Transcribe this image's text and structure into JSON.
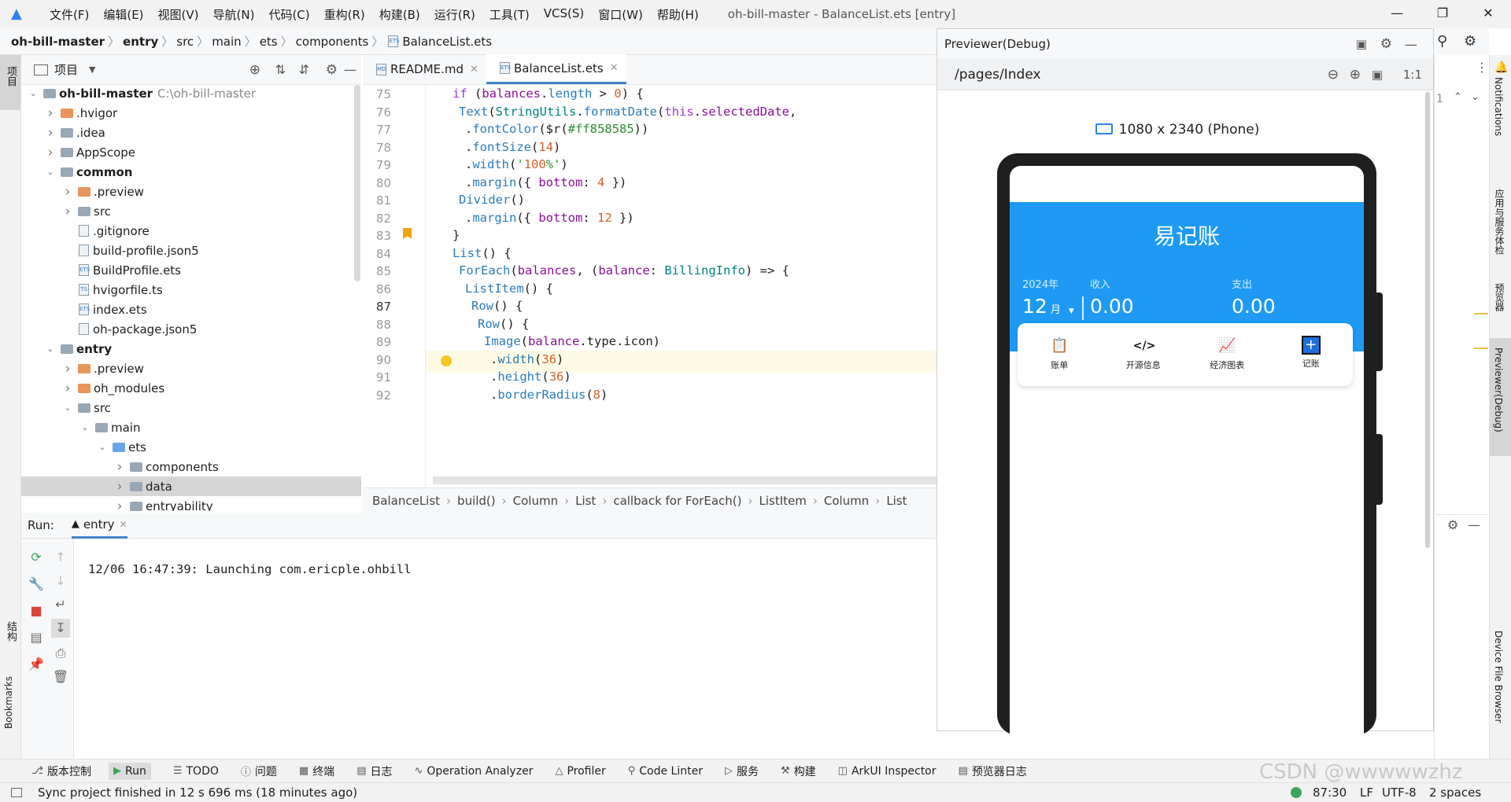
{
  "window": {
    "title": "oh-bill-master - BalanceList.ets [entry]",
    "menu": [
      "文件(F)",
      "编辑(E)",
      "视图(V)",
      "导航(N)",
      "代码(C)",
      "重构(R)",
      "构建(B)",
      "运行(R)",
      "工具(T)",
      "VCS(S)",
      "窗口(W)",
      "帮助(H)"
    ]
  },
  "breadcrumb": [
    "oh-bill-master",
    "entry",
    "src",
    "main",
    "ets",
    "components",
    "BalanceList.ets"
  ],
  "project": {
    "title": "项目",
    "tree": [
      {
        "label": "oh-bill-master",
        "extra": "C:\\oh-bill-master",
        "depth": 0,
        "arrow": "open",
        "icon": "module",
        "bold": true
      },
      {
        "label": ".hvigor",
        "depth": 1,
        "arrow": "closed",
        "icon": "folder-orange"
      },
      {
        "label": ".idea",
        "depth": 1,
        "arrow": "closed",
        "icon": "folder"
      },
      {
        "label": "AppScope",
        "depth": 1,
        "arrow": "closed",
        "icon": "folder"
      },
      {
        "label": "common",
        "depth": 1,
        "arrow": "open",
        "icon": "module",
        "bold": true
      },
      {
        "label": ".preview",
        "depth": 2,
        "arrow": "closed",
        "icon": "folder-orange"
      },
      {
        "label": "src",
        "depth": 2,
        "arrow": "closed",
        "icon": "folder"
      },
      {
        "label": ".gitignore",
        "depth": 2,
        "icon": "file"
      },
      {
        "label": "build-profile.json5",
        "depth": 2,
        "icon": "file"
      },
      {
        "label": "BuildProfile.ets",
        "depth": 2,
        "icon": "file-ets"
      },
      {
        "label": "hvigorfile.ts",
        "depth": 2,
        "icon": "file-ts"
      },
      {
        "label": "index.ets",
        "depth": 2,
        "icon": "file-ets"
      },
      {
        "label": "oh-package.json5",
        "depth": 2,
        "icon": "file"
      },
      {
        "label": "entry",
        "depth": 1,
        "arrow": "open",
        "icon": "module",
        "bold": true
      },
      {
        "label": ".preview",
        "depth": 2,
        "arrow": "closed",
        "icon": "folder-orange"
      },
      {
        "label": "oh_modules",
        "depth": 2,
        "arrow": "closed",
        "icon": "folder-orange"
      },
      {
        "label": "src",
        "depth": 2,
        "arrow": "open",
        "icon": "folder"
      },
      {
        "label": "main",
        "depth": 3,
        "arrow": "open",
        "icon": "folder"
      },
      {
        "label": "ets",
        "depth": 4,
        "arrow": "open",
        "icon": "folder-blue"
      },
      {
        "label": "components",
        "depth": 5,
        "arrow": "closed",
        "icon": "folder"
      },
      {
        "label": "data",
        "depth": 5,
        "arrow": "closed",
        "icon": "folder",
        "selected": true
      },
      {
        "label": "entryability",
        "depth": 5,
        "arrow": "closed",
        "icon": "folder"
      }
    ]
  },
  "editor": {
    "tabs": [
      {
        "label": "README.md",
        "icon": "MD",
        "active": false
      },
      {
        "label": "BalanceList.ets",
        "icon": "ETS",
        "active": true
      }
    ],
    "current_line": "87",
    "lines": [
      {
        "n": "75",
        "code": "if (balances.length > 0) {"
      },
      {
        "n": "76",
        "code": "  Text(StringUtils.formatDate(this.selectedDate,"
      },
      {
        "n": "77",
        "code": "    .fontColor($r(#ff858585))"
      },
      {
        "n": "78",
        "code": "    .fontSize(14)"
      },
      {
        "n": "79",
        "code": "    .width('100%')"
      },
      {
        "n": "80",
        "code": "    .margin({ bottom: 4 })"
      },
      {
        "n": "81",
        "code": "  Divider()"
      },
      {
        "n": "82",
        "code": "    .margin({ bottom: 12 })"
      },
      {
        "n": "83",
        "code": "}"
      },
      {
        "n": "84",
        "code": "List() {"
      },
      {
        "n": "85",
        "code": "  ForEach(balances, (balance: BillingInfo) => {"
      },
      {
        "n": "86",
        "code": "    ListItem() {"
      },
      {
        "n": "87",
        "code": "      Row() {"
      },
      {
        "n": "88",
        "code": "        Row() {"
      },
      {
        "n": "89",
        "code": "          Image(balance.type.icon)"
      },
      {
        "n": "90",
        "code": "            .width(36)"
      },
      {
        "n": "91",
        "code": "            .height(36)"
      },
      {
        "n": "92",
        "code": "            .borderRadius(8)"
      }
    ],
    "crumbs": [
      "BalanceList",
      "build()",
      "Column",
      "List",
      "callback for ForEach()",
      "ListItem",
      "Column",
      "List"
    ]
  },
  "run": {
    "label": "Run:",
    "config": "entry",
    "output": "12/06 16:47:39: Launching com.ericple.ohbill"
  },
  "previewer": {
    "title": "Previewer(Debug)",
    "route": "/pages/Index",
    "device": "1080 x 2340 (Phone)",
    "zoom": "1:1",
    "app": {
      "title": "易记账",
      "year": "2024年",
      "month": "12",
      "month_unit": "月",
      "income_label": "收入",
      "income": "0.00",
      "expense_label": "支出",
      "expense": "0.00",
      "menu": [
        {
          "label": "账单",
          "icon": "clipboard-icon"
        },
        {
          "label": "开源信息",
          "icon": "code-icon"
        },
        {
          "label": "经济图表",
          "icon": "chart-icon"
        },
        {
          "label": "记账",
          "icon": "plus-box-icon"
        }
      ],
      "accent": "#1e9af5"
    }
  },
  "left_stripe": [
    "项目",
    "结构",
    "Bookmarks"
  ],
  "right_stripe": [
    "Notifications",
    "应用与服务体检",
    "预览器",
    "Previewer(Debug)",
    "Device File Browser"
  ],
  "editor_right_gutter": "1",
  "tool_tabs": [
    "版本控制",
    "Run",
    "TODO",
    "问题",
    "终端",
    "日志",
    "Operation Analyzer",
    "Profiler",
    "Code Linter",
    "服务",
    "构建",
    "ArkUI Inspector",
    "预览器日志"
  ],
  "status": {
    "message": "Sync project finished in 12 s 696 ms (18 minutes ago)",
    "position": "87:30",
    "line_sep": "LF",
    "encoding": "UTF-8",
    "indent": "2 spaces"
  },
  "watermark": "CSDN @wwwwwzhz"
}
